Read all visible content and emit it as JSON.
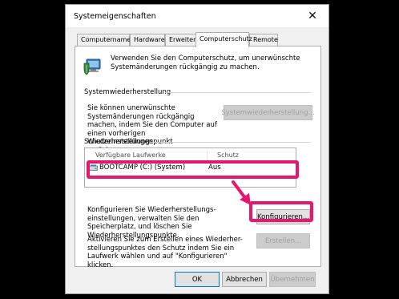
{
  "window": {
    "title": "Systemeigenschaften",
    "close_glyph": "✕"
  },
  "tabs": [
    {
      "label": "Computername",
      "active": false
    },
    {
      "label": "Hardware",
      "active": false
    },
    {
      "label": "Erweitert",
      "active": false
    },
    {
      "label": "Computerschutz",
      "active": true
    },
    {
      "label": "Remote",
      "active": false
    }
  ],
  "intro": {
    "text": "Verwenden Sie den Computerschutz, um unerwünschte Systemänderungen rückgängig zu machen.",
    "icon": "shield-computer-icon"
  },
  "restore": {
    "group_label": "Systemwiederherstellung",
    "description": "Sie können unerwünschte Systemänderungen rückgängig machen, indem Sie den Computer auf einen vorherigen Wiederherstellungspunkt zurücksetzen.",
    "button_label": "Systemwiederherstellung..."
  },
  "protection": {
    "group_label": "Schutzeinstellungen",
    "columns": [
      "Verfügbare Laufwerke",
      "Schutz"
    ],
    "drives": [
      {
        "name": "BOOTCAMP (C:) (System)",
        "status": "Aus",
        "icon": "drive-icon"
      }
    ],
    "configure_text": "Konfigurieren Sie Wiederherstellungs-einstellungen, verwalten Sie den Speicherplatz, und löschen Sie Wiederherstellungspunkte.",
    "configure_button": "Konfigurieren...",
    "create_text": "Aktivieren Sie zum Erstellen eines Wiederher-stellungspunktes den Schutz indem Sie ein Laufwerk wählen und auf \"Konfigurieren\" klicken.",
    "create_button": "Erstellen..."
  },
  "footer": {
    "ok": "OK",
    "cancel": "Abbrechen",
    "apply": "Übernehmen"
  },
  "colors": {
    "highlight": "#e8176e",
    "focus": "#0078d7"
  }
}
